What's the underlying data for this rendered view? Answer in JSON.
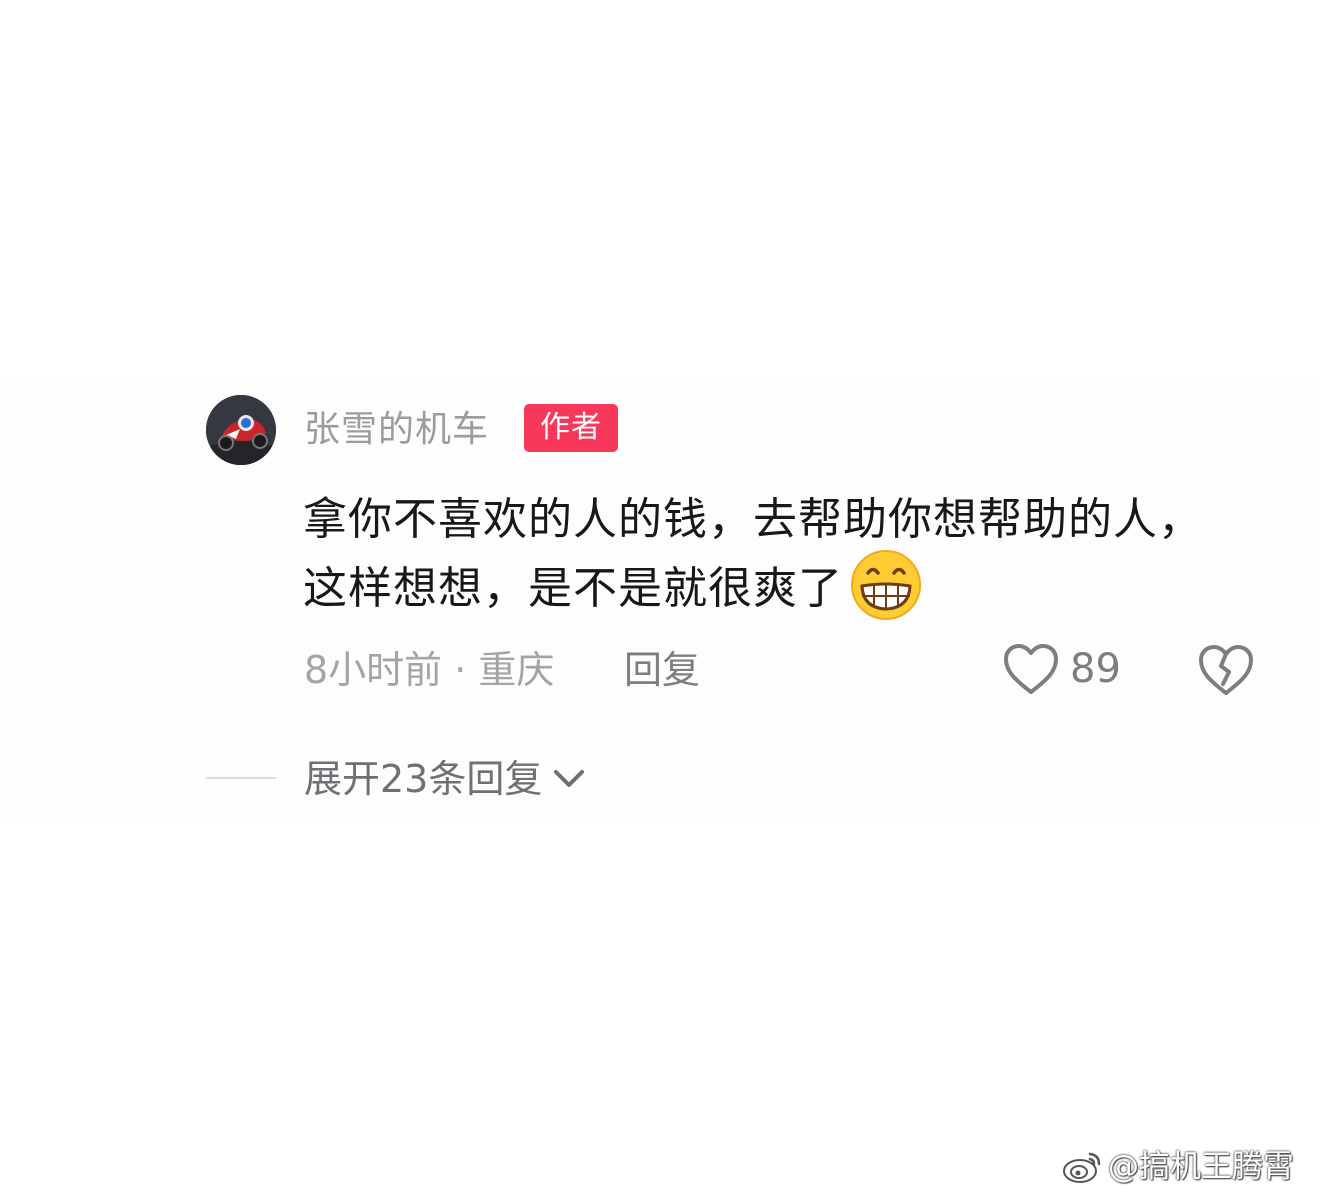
{
  "comment": {
    "username": "张雪的机车",
    "author_badge": "作者",
    "text_line1": "拿你不喜欢的人的钱，去帮助你想帮助的人，",
    "text_line2": "这样想想，是不是就很爽了",
    "emoji": "grinning-face-emoji",
    "meta": "8小时前 · 重庆",
    "reply_label": "回复",
    "like_count": "89",
    "expand_label": "展开23条回复",
    "badge_color": "#f7385a"
  },
  "watermark": {
    "text": "@搞机王腾霄",
    "icon": "weibo-logo"
  }
}
